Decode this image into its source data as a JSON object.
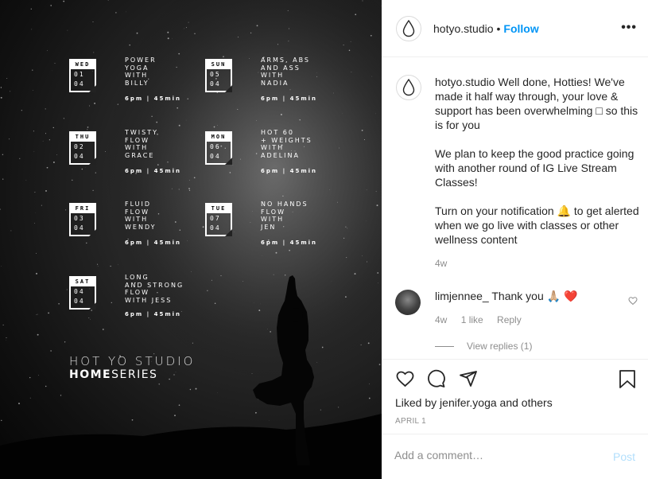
{
  "image": {
    "schedule": [
      {
        "day": "WED",
        "date": [
          "01",
          "04"
        ],
        "title": "POWER\nYOga\nWITH\nBILLY",
        "time": "6pm | 45min"
      },
      {
        "day": "SUN",
        "date": [
          "05",
          "04"
        ],
        "title": "ARMS, ABS\nAND ASS\nWITH\nNADIA",
        "time": "6pm | 45min"
      },
      {
        "day": "THU",
        "date": [
          "02",
          "04"
        ],
        "title": "TWISTY\nFLOW\nWITH\nGRACE",
        "time": "6pm | 45min"
      },
      {
        "day": "MON",
        "date": [
          "06",
          "04"
        ],
        "title": "HOT 60\n+ WEIGHTS\nWITH\nADELINA",
        "time": "6pm | 45min"
      },
      {
        "day": "FRI",
        "date": [
          "03",
          "04"
        ],
        "title": "FLUID\nFLOW\nWITH\nWENDY",
        "time": "6pm | 45min"
      },
      {
        "day": "TUE",
        "date": [
          "07",
          "04"
        ],
        "title": "NO HANDS\nFLOW\nWITH\nJEN",
        "time": "6pm | 45min"
      },
      {
        "day": "SAT",
        "date": [
          "04",
          "04"
        ],
        "title": "LONG\nAND STRONG\nFLOW\nWITH JESS",
        "time": "6pm | 45min"
      }
    ],
    "brand_line1": "HOT YO STUDIO",
    "brand_line2_bold": "HOME",
    "brand_line2_rest": "SERIES"
  },
  "header": {
    "username": "hotyo.studio",
    "dot": "•",
    "follow_label": "Follow",
    "more_icon": "more-horizontal-icon"
  },
  "caption": {
    "username": "hotyo.studio",
    "para1": "Well done, Hotties! We've made it half way through, your love & support has been overwhelming □ so this is for you",
    "para2": "We plan to keep the good practice going with another round of IG Live Stream Classes!",
    "para3_before": "Turn on your notification ",
    "para3_emoji": "🔔",
    "para3_after": " to get alerted when we go live with classes or other wellness content",
    "age": "4w"
  },
  "comment": {
    "username": "limjennee_",
    "text": "Thank you 🙏🏼 ❤️",
    "age": "4w",
    "likes": "1 like",
    "reply_label": "Reply",
    "view_replies": "View replies (1)"
  },
  "actions": {
    "liked_by_prefix": "Liked by ",
    "liked_by_user": "jenifer.yoga",
    "liked_by_suffix": " and ",
    "liked_by_others": "others",
    "date": "APRIL 1"
  },
  "add_comment": {
    "placeholder": "Add a comment…",
    "post_label": "Post"
  },
  "colors": {
    "accent": "#0095f6",
    "post_disabled": "#b2dffc",
    "text": "#262626",
    "muted": "#8e8e8e"
  }
}
